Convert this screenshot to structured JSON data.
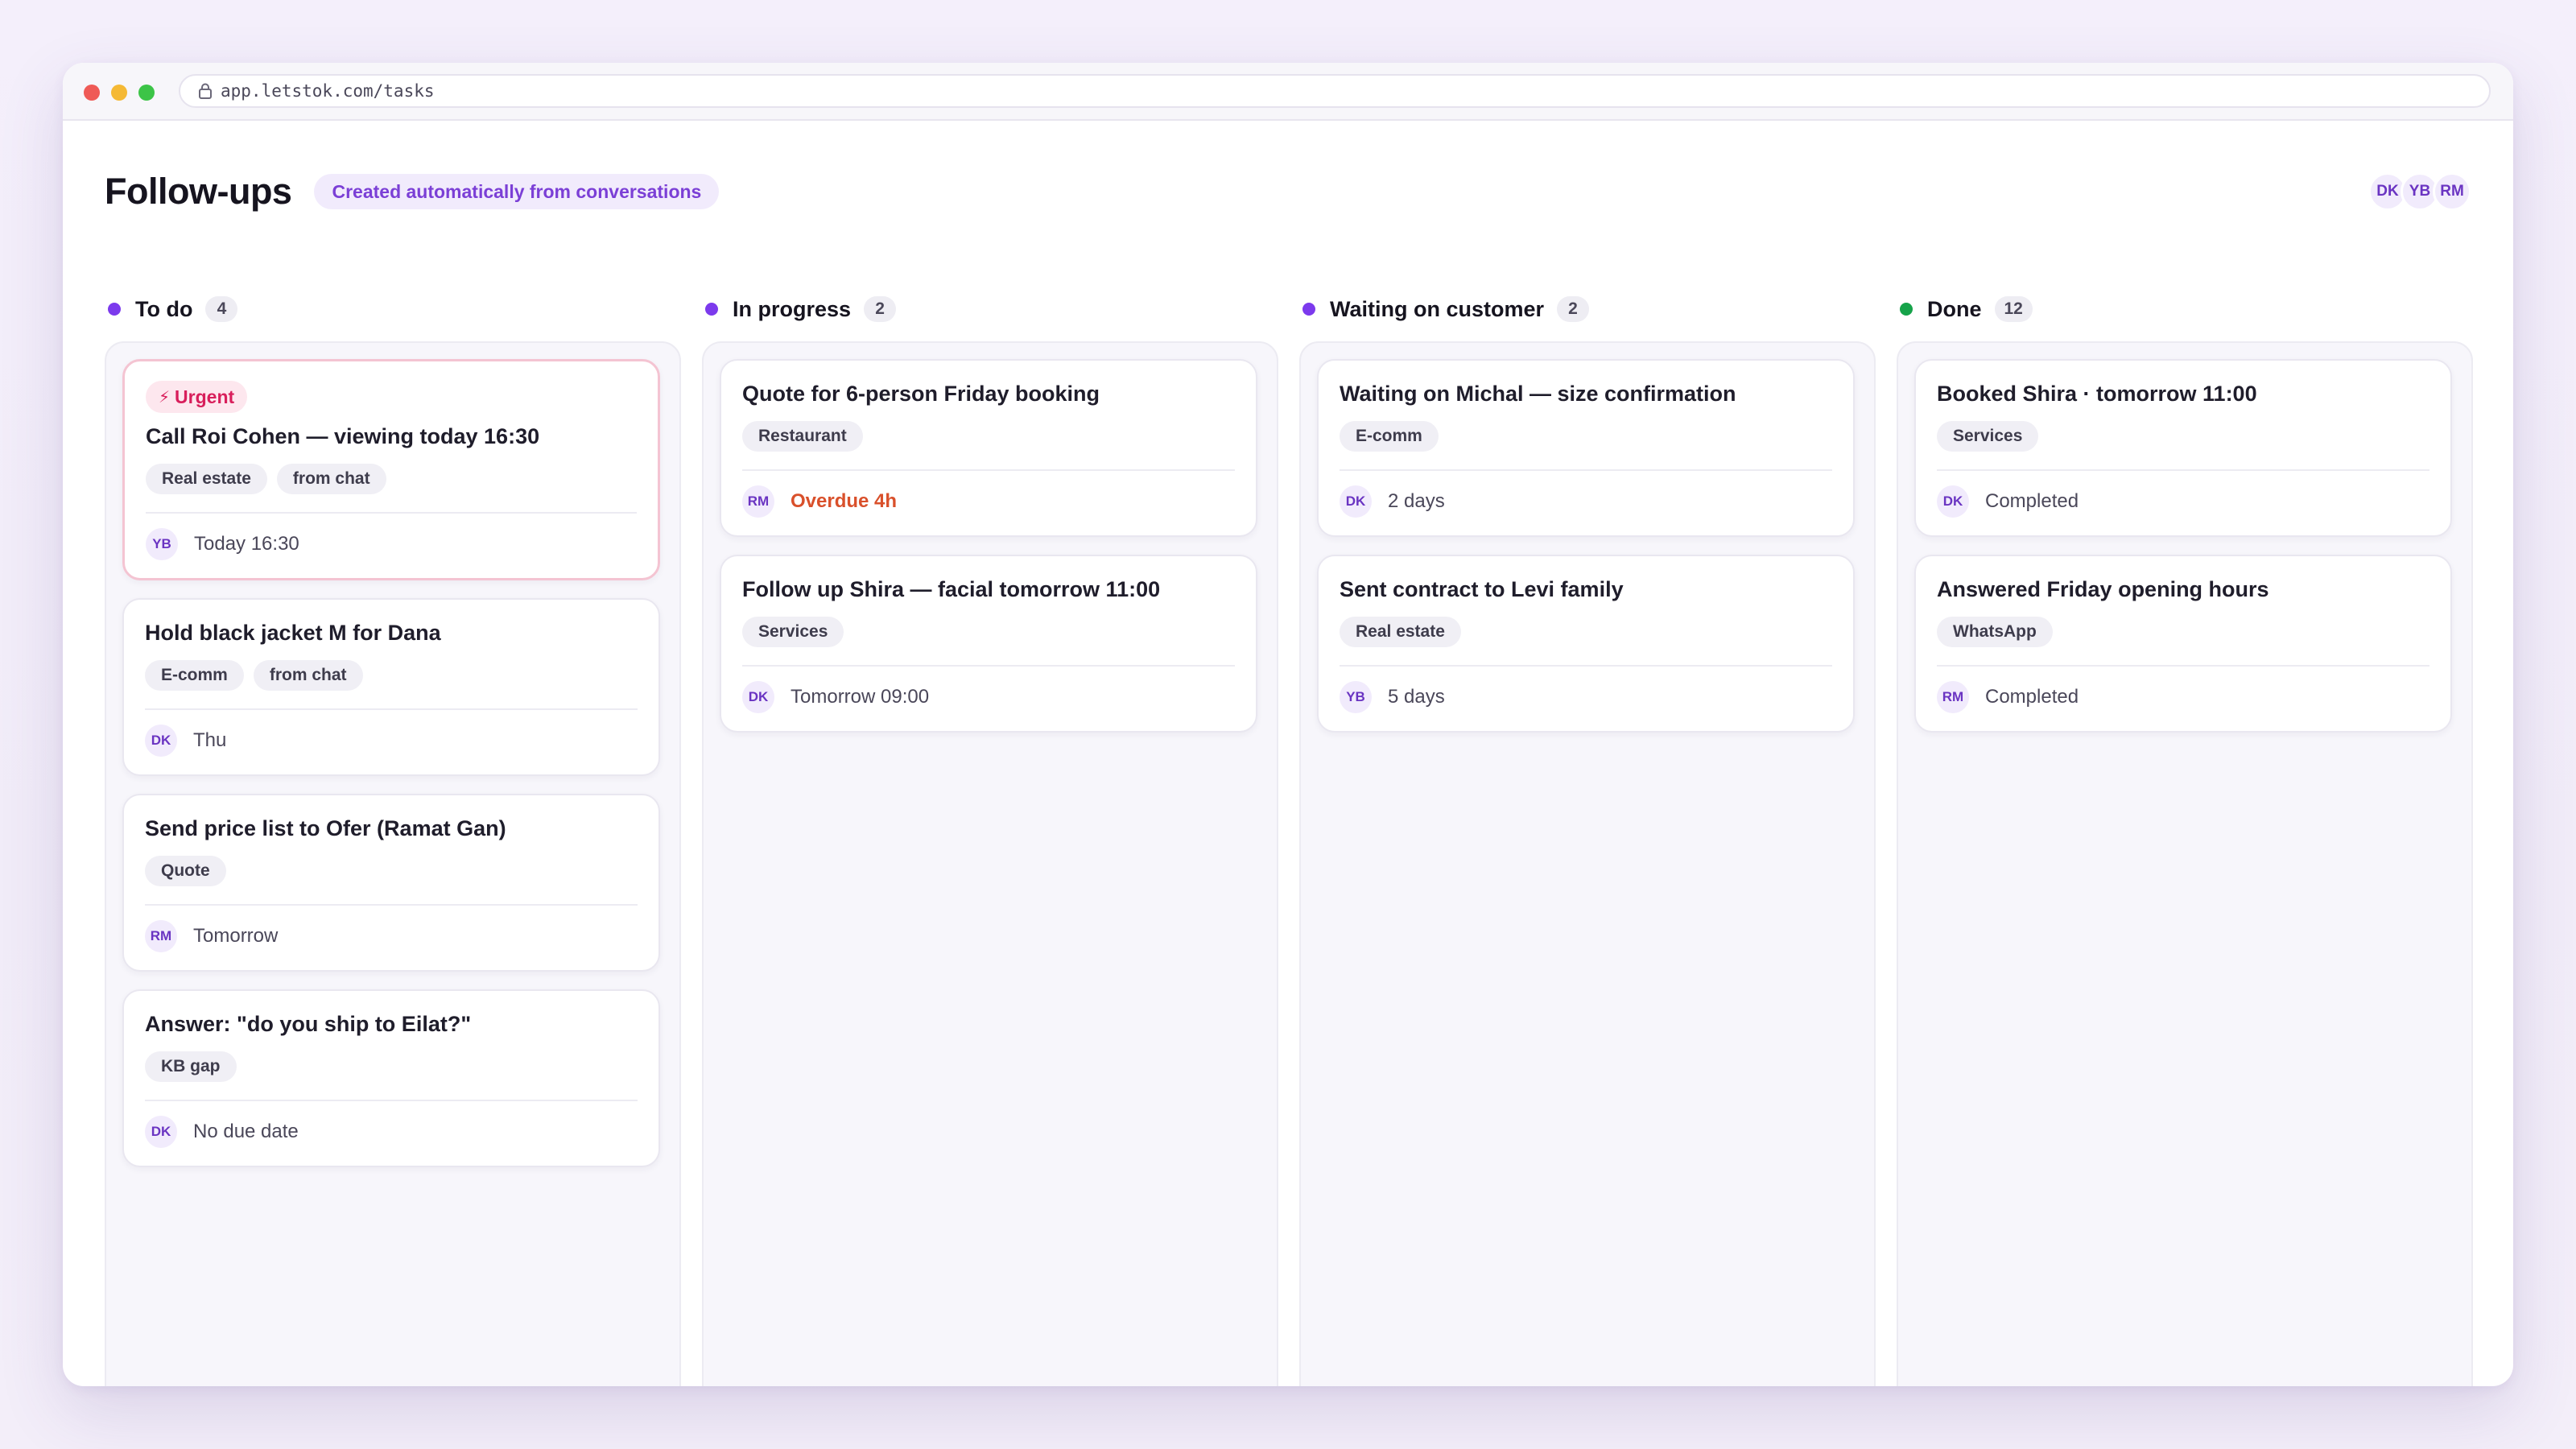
{
  "browser": {
    "url": "app.letstok.com/tasks"
  },
  "header": {
    "title": "Follow-ups",
    "badge": "Created automatically from conversations",
    "team": [
      "DK",
      "YB",
      "RM"
    ]
  },
  "colors": {
    "accent": "#7b3fd6",
    "todo_dot": "#7c3aed",
    "progress_dot": "#7c3aed",
    "waiting_dot": "#7c3aed",
    "done_dot": "#16a34a",
    "urgent": "#d81e5b",
    "overdue": "#d9502b"
  },
  "columns": [
    {
      "title": "To do",
      "count": "4",
      "cards": [
        {
          "urgent_label": "Urgent",
          "title": "Call Roi Cohen — viewing today 16:30",
          "tags": [
            "Real estate",
            "from chat"
          ],
          "assignee": "YB",
          "due": "Today 16:30"
        },
        {
          "title": "Hold black jacket M for Dana",
          "tags": [
            "E-comm",
            "from chat"
          ],
          "assignee": "DK",
          "due": "Thu"
        },
        {
          "title": "Send price list to Ofer (Ramat Gan)",
          "tags": [
            "Quote"
          ],
          "assignee": "RM",
          "due": "Tomorrow"
        },
        {
          "title": "Answer: \"do you ship to Eilat?\"",
          "tags": [
            "KB gap"
          ],
          "assignee": "DK",
          "due": "No due date"
        }
      ]
    },
    {
      "title": "In progress",
      "count": "2",
      "cards": [
        {
          "title": "Quote for 6-person Friday booking",
          "tags": [
            "Restaurant"
          ],
          "assignee": "RM",
          "due": "Overdue 4h"
        },
        {
          "title": "Follow up Shira — facial tomorrow 11:00",
          "tags": [
            "Services"
          ],
          "assignee": "DK",
          "due": "Tomorrow 09:00"
        }
      ]
    },
    {
      "title": "Waiting on customer",
      "count": "2",
      "cards": [
        {
          "title": "Waiting on Michal — size confirmation",
          "tags": [
            "E-comm"
          ],
          "assignee": "DK",
          "due": "2 days"
        },
        {
          "title": "Sent contract to Levi family",
          "tags": [
            "Real estate"
          ],
          "assignee": "YB",
          "due": "5 days"
        }
      ]
    },
    {
      "title": "Done",
      "count": "12",
      "cards": [
        {
          "title": "Booked Shira · tomorrow 11:00",
          "tags": [
            "Services"
          ],
          "assignee": "DK",
          "due": "Completed"
        },
        {
          "title": "Answered Friday opening hours",
          "tags": [
            "WhatsApp"
          ],
          "assignee": "RM",
          "due": "Completed"
        }
      ]
    }
  ]
}
